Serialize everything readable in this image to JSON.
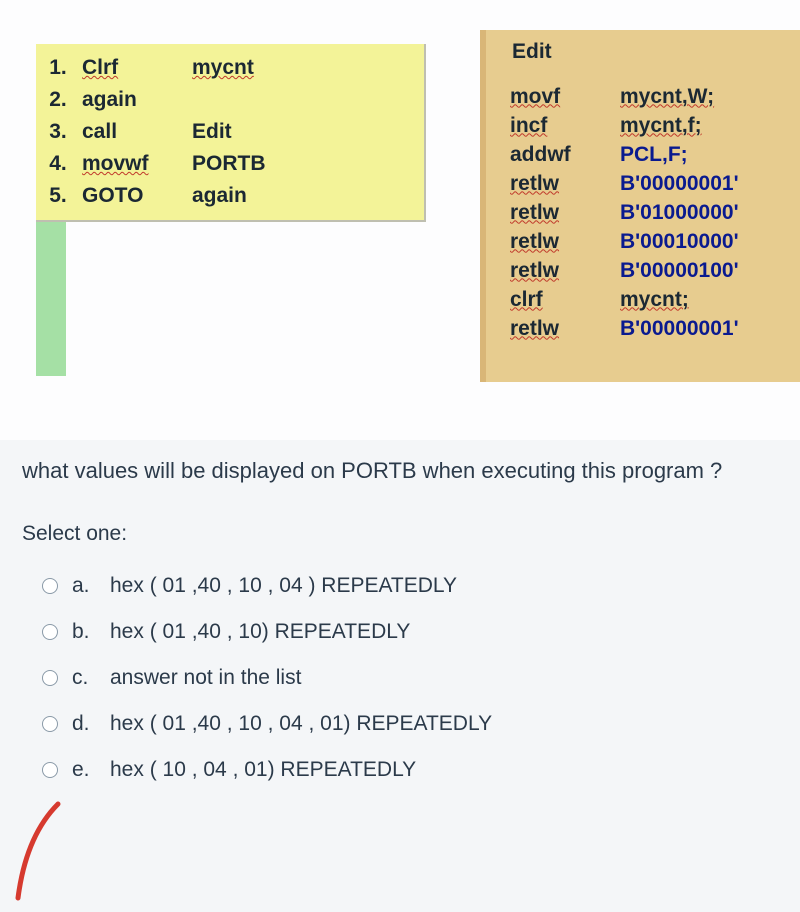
{
  "code_left": {
    "rows": [
      {
        "n": "1.",
        "op": "Clrf",
        "op_sq": true,
        "arg": "mycnt",
        "arg_sq": true
      },
      {
        "n": "2.",
        "op": "again",
        "op_sq": false,
        "arg": "",
        "arg_sq": false
      },
      {
        "n": "3.",
        "op": "call",
        "op_sq": false,
        "arg": "Edit",
        "arg_sq": false
      },
      {
        "n": "4.",
        "op": "movwf",
        "op_sq": true,
        "arg": "PORTB",
        "arg_sq": false
      },
      {
        "n": "5.",
        "op": "GOTO",
        "op_sq": false,
        "arg": "again",
        "arg_sq": false
      }
    ]
  },
  "code_right": {
    "title": "Edit",
    "rows": [
      {
        "c1": "movf",
        "c1_sq": true,
        "c2": "mycnt,W;",
        "c2_sq": true,
        "c2_blue": false
      },
      {
        "c1": "incf",
        "c1_sq": true,
        "c2": "mycnt,f;",
        "c2_sq": true,
        "c2_blue": false
      },
      {
        "c1": "addwf",
        "c1_sq": false,
        "c2": "PCL,F;",
        "c2_sq": false,
        "c2_blue": true
      },
      {
        "c1": "retlw",
        "c1_sq": true,
        "c2": "B'00000001'",
        "c2_sq": false,
        "c2_blue": true
      },
      {
        "c1": "retlw",
        "c1_sq": true,
        "c2": "B'01000000'",
        "c2_sq": false,
        "c2_blue": true
      },
      {
        "c1": "retlw",
        "c1_sq": true,
        "c2": "B'00010000'",
        "c2_sq": false,
        "c2_blue": true
      },
      {
        "c1": "retlw",
        "c1_sq": true,
        "c2": "B'00000100'",
        "c2_sq": false,
        "c2_blue": true
      },
      {
        "c1": "clrf",
        "c1_sq": true,
        "c2": "mycnt;",
        "c2_sq": true,
        "c2_blue": false
      },
      {
        "c1": "retlw",
        "c1_sq": true,
        "c2": "B'00000001'",
        "c2_sq": false,
        "c2_blue": true
      }
    ]
  },
  "question": "what values will be displayed on PORTB  when executing this program ?",
  "select_label": "Select one:",
  "options": [
    {
      "letter": "a.",
      "text": "hex ( 01 ,40 , 10 , 04 )    REPEATEDLY"
    },
    {
      "letter": "b.",
      "text": "hex ( 01 ,40 , 10)    REPEATEDLY"
    },
    {
      "letter": "c.",
      "text": "answer not in the list"
    },
    {
      "letter": "d.",
      "text": "hex ( 01 ,40 , 10 , 04 , 01)    REPEATEDLY"
    },
    {
      "letter": "e.",
      "text": "hex ( 10 , 04 , 01)    REPEATEDLY"
    }
  ]
}
